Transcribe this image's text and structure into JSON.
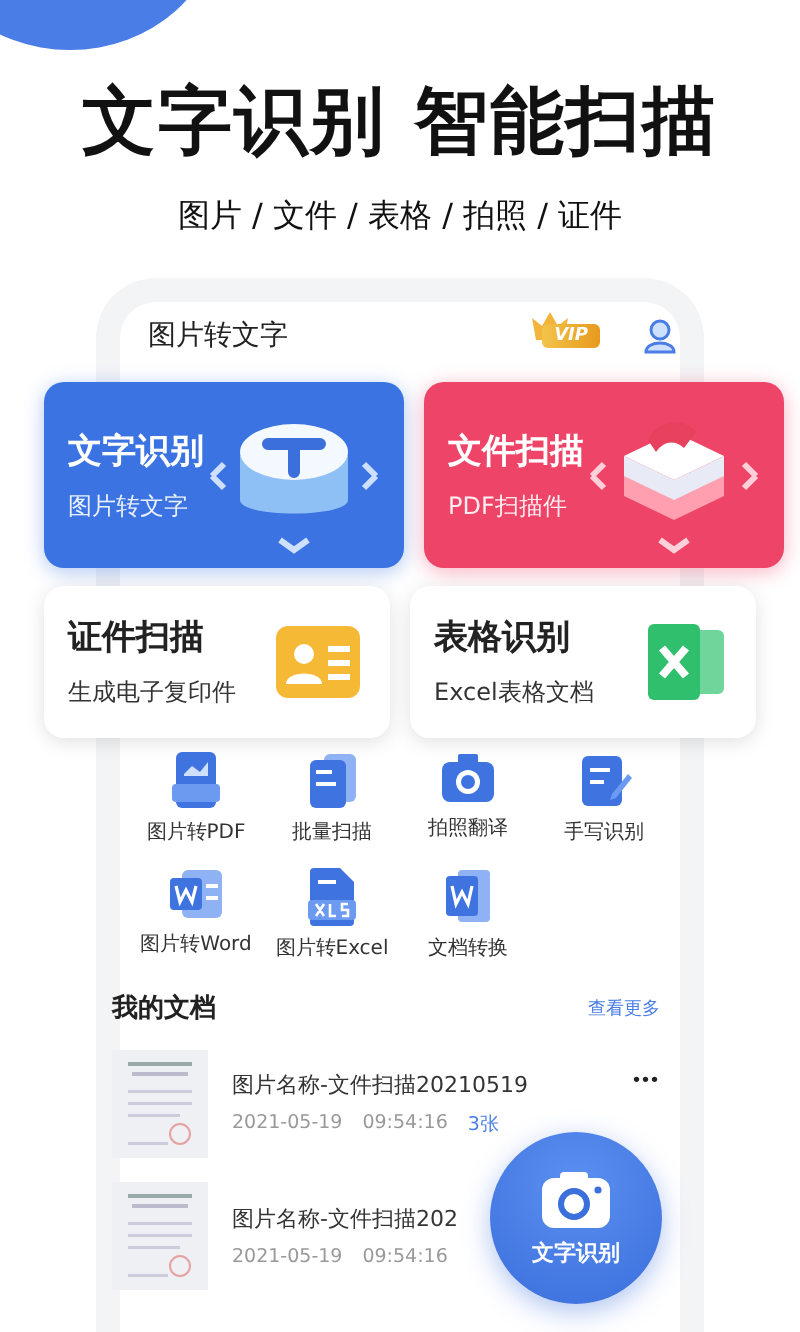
{
  "headline": "文字识别 智能扫描",
  "subtitle": "图片 / 文件 / 表格 / 拍照 / 证件",
  "app": {
    "title": "图片转文字",
    "vip": "VIP",
    "feature_cards": [
      {
        "kind": "text",
        "title": "文字识别",
        "subtitle": "图片转文字"
      },
      {
        "kind": "file",
        "title": "文件扫描",
        "subtitle": "PDF扫描件"
      }
    ],
    "secondary_cards": [
      {
        "kind": "id",
        "title": "证件扫描",
        "subtitle": "生成电子复印件"
      },
      {
        "kind": "excel",
        "title": "表格识别",
        "subtitle": "Excel表格文档"
      }
    ],
    "tools": [
      {
        "kind": "pdf",
        "label": "图片转PDF"
      },
      {
        "kind": "batch",
        "label": "批量扫描"
      },
      {
        "kind": "camera",
        "label": "拍照翻译"
      },
      {
        "kind": "write",
        "label": "手写识别"
      },
      {
        "kind": "word",
        "label": "图片转Word"
      },
      {
        "kind": "xls",
        "label": "图片转Excel"
      },
      {
        "kind": "convert",
        "label": "文档转换"
      }
    ],
    "documents": {
      "title": "我的文档",
      "more": "查看更多",
      "items": [
        {
          "name": "图片名称-文件扫描20210519",
          "date": "2021-05-19",
          "time": "09:54:16",
          "count": "3张",
          "menu": "•••"
        },
        {
          "name": "图片名称-文件扫描202",
          "date": "2021-05-19",
          "time": "09:54:16"
        }
      ]
    },
    "fab": {
      "label": "文字识别"
    }
  }
}
